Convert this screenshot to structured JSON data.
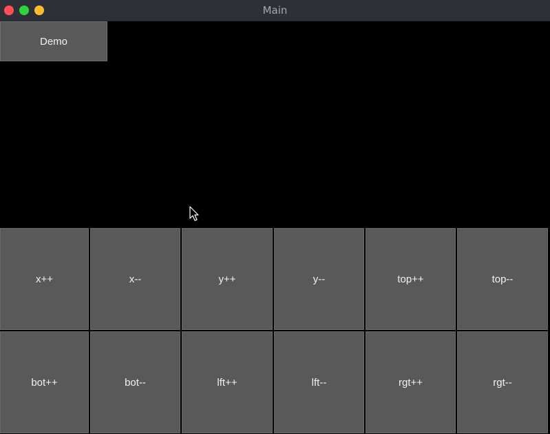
{
  "window": {
    "title": "Main",
    "controls": {
      "close_color": "#ff4f58",
      "minimize_color": "#2fd33c",
      "maximize_color": "#ffbd2e"
    }
  },
  "demo_button": {
    "label": "Demo"
  },
  "pad": {
    "row1": [
      "x++",
      "x--",
      "y++",
      "y--",
      "top++",
      "top--"
    ],
    "row2": [
      "bot++",
      "bot--",
      "lft++",
      "lft--",
      "rgt++",
      "rgt--"
    ]
  },
  "cursor": {
    "icon": "arrow-cursor-icon"
  },
  "colors": {
    "canvas_bg": "#000000",
    "button_bg": "#595959",
    "titlebar_bg": "#2e3037"
  }
}
